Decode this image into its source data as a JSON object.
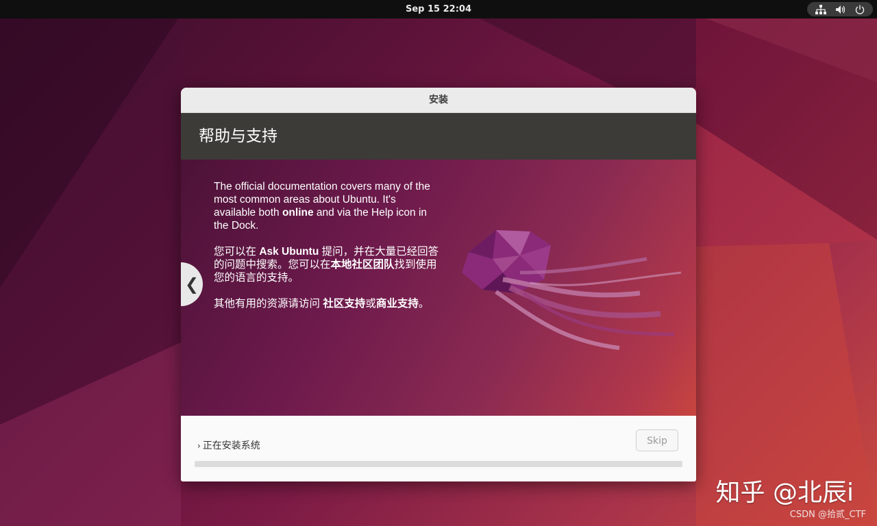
{
  "topbar": {
    "clock": "Sep 15  22:04",
    "icons": [
      "network-icon",
      "volume-icon",
      "power-icon"
    ]
  },
  "window": {
    "title": "安装",
    "section_title": "帮助与支持",
    "slide": {
      "p1_a": "The official documentation covers many of the most common areas about Ubuntu. It's available both ",
      "p1_bold": "online",
      "p1_b": " and via the Help icon in the Dock.",
      "p2_a": "您可以在 ",
      "p2_bold1": "Ask Ubuntu",
      "p2_b": " 提问，并在大量已经回答的问题中搜索。您可以在",
      "p2_bold2": "本地社区团队",
      "p2_c": "找到使用您的语言的支持。",
      "p3_a": "其他有用的资源请访问 ",
      "p3_bold1": "社区支持",
      "p3_b": "或",
      "p3_bold2": "商业支持",
      "p3_c": "。"
    },
    "prev_label": "❮",
    "status_chevron": "›",
    "status_text": "正在安装系统",
    "skip_label": "Skip",
    "progress": 0
  },
  "watermark": {
    "main": "知乎 @北辰i",
    "sub": "CSDN @拾贰_CTF"
  },
  "colors": {
    "topbar": "#0f0f0f",
    "header": "#3c3b37",
    "accent": "#e95420"
  }
}
